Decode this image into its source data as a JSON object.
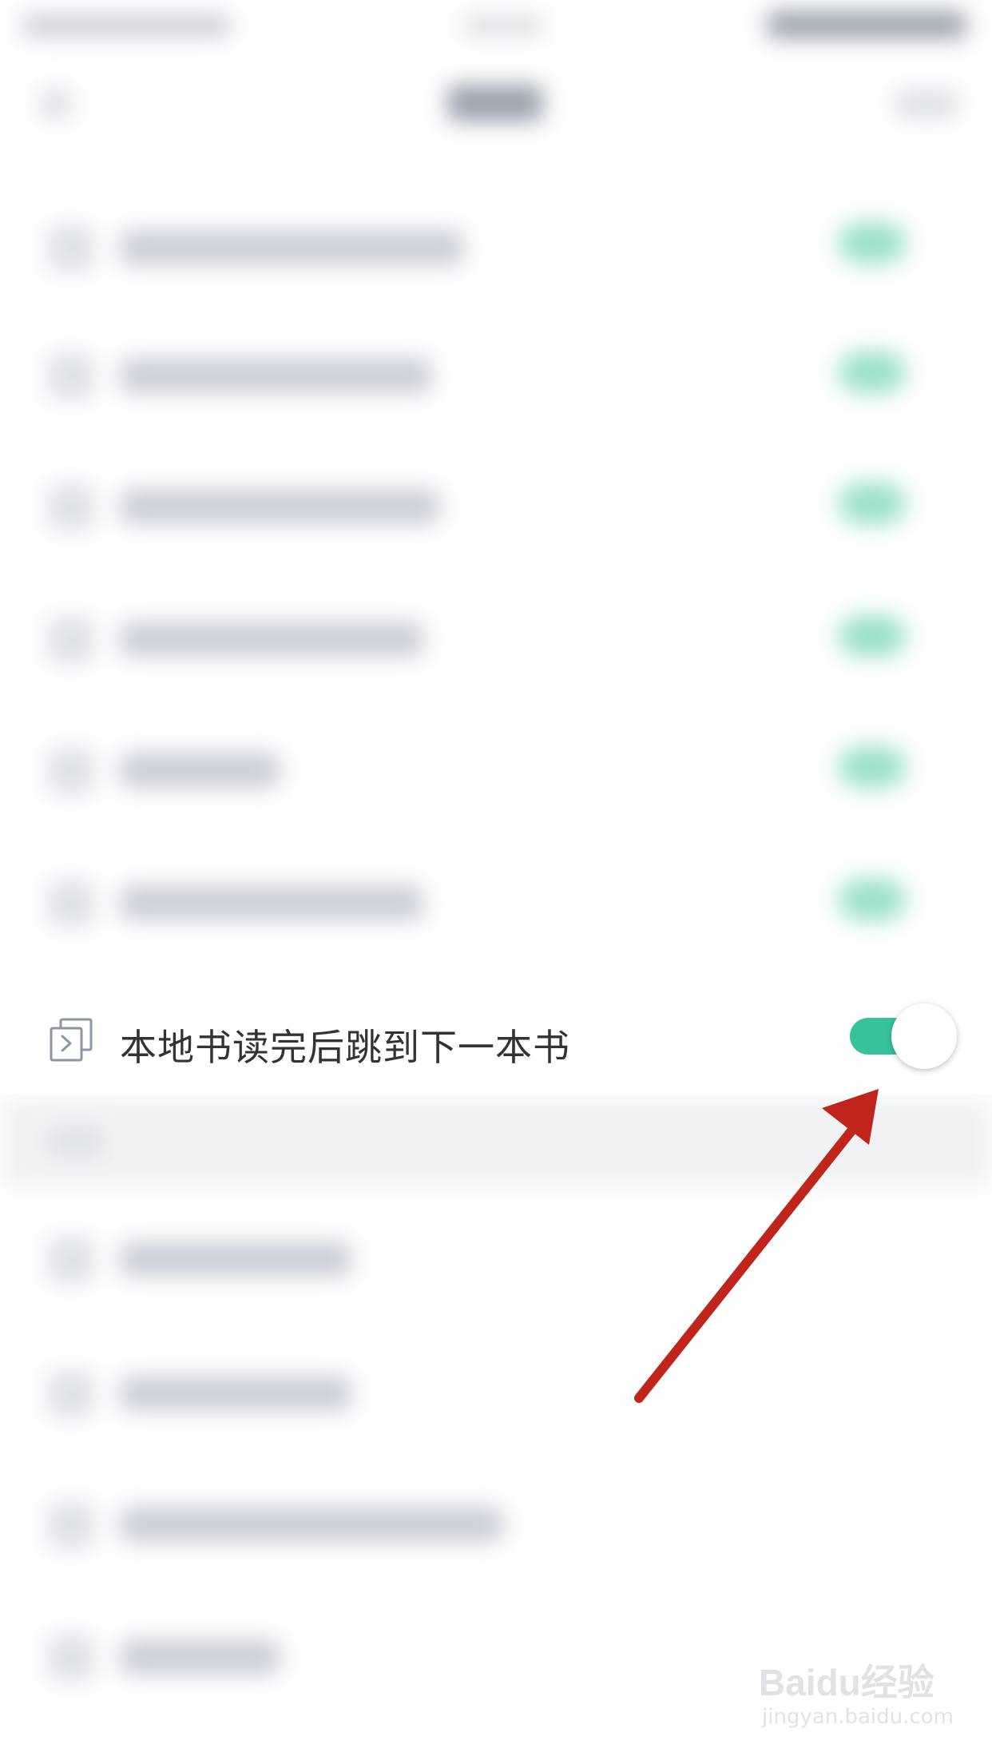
{
  "setting_row": {
    "label": "本地书读完后跳到下一本书",
    "toggle_state": "on",
    "accent_color": "#37c29c",
    "icon": "next-book-icon"
  },
  "annotation": {
    "arrow_color": "#c0251b"
  },
  "watermark": {
    "brand": "Baidu经验",
    "url": "jingyan.baidu.com"
  }
}
